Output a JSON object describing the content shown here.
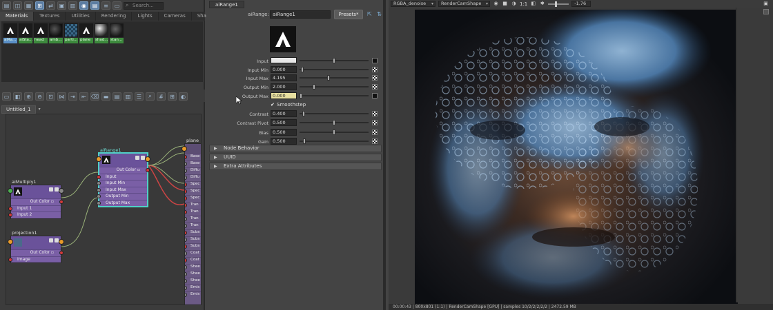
{
  "hypershade": {
    "search_placeholder": "Search...",
    "tabs": [
      "Materials",
      "Textures",
      "Utilities",
      "Rendering",
      "Lights",
      "Cameras",
      "Shading Gr"
    ],
    "swatches": [
      {
        "label": "aiRa...",
        "kind": "arnold"
      },
      {
        "label": "aiSta...",
        "kind": "arnold"
      },
      {
        "label": "head",
        "kind": "arnold"
      },
      {
        "label": "amb...",
        "kind": "dark"
      },
      {
        "label": "parti...",
        "kind": "checker"
      },
      {
        "label": "plane",
        "kind": "arnold"
      },
      {
        "label": "shad...",
        "kind": "sphere"
      },
      {
        "label": "stan...",
        "kind": "dark"
      }
    ],
    "graph_tab": "Untitled_1"
  },
  "nodes": {
    "multiply": {
      "title": "aiMultiply1",
      "out": "Out Color",
      "inputs": [
        "Input 1",
        "Input 2"
      ]
    },
    "projection": {
      "title": "projection1",
      "out": "Out Color",
      "inputs": [
        "Image"
      ]
    },
    "range": {
      "title": "aiRange1",
      "out": "Out Color",
      "inputs": [
        "Input",
        "Input Min",
        "Input Max",
        "Output Min",
        "Output Max"
      ]
    },
    "plane": {
      "title": "plane",
      "rows": [
        "Base",
        "Base",
        "Diffu",
        "Diffu",
        "Spec",
        "Spec",
        "Spec",
        "Tran",
        "Tran",
        "Tran",
        "Tran",
        "Subs",
        "Subs",
        "Subs",
        "Coat",
        "Coat",
        "Shee",
        "Shee",
        "Shee",
        "Emis",
        "Emis"
      ]
    }
  },
  "attribute_editor": {
    "tab": "aiRange1",
    "name_label": "aiRange:",
    "name_value": "aiRange1",
    "presets_label": "Presets*",
    "attributes": [
      {
        "label": "Input",
        "type": "color",
        "knob": 0.5,
        "map": "solid"
      },
      {
        "label": "Input Min",
        "type": "float",
        "value": "0.000",
        "knob": 0.02,
        "map": "check"
      },
      {
        "label": "Input Max",
        "type": "float",
        "value": "4.195",
        "knob": 0.42,
        "map": "check"
      },
      {
        "label": "Output Min",
        "type": "float",
        "value": "2.000",
        "knob": 0.2,
        "map": "check"
      },
      {
        "label": "Output Max",
        "type": "float",
        "value": "0.000",
        "knob": 0.0,
        "map": "solid",
        "highlight": true
      }
    ],
    "smoothstep_label": "Smoothstep",
    "attributes2": [
      {
        "label": "Contrast",
        "value": "0.400",
        "knob": 0.04,
        "map": "check"
      },
      {
        "label": "Contrast Pivot",
        "value": "0.500",
        "knob": 0.5,
        "map": "check"
      },
      {
        "label": "Bias",
        "value": "0.500",
        "knob": 0.5,
        "map": "check"
      },
      {
        "label": "Gain",
        "value": "0.500",
        "knob": 0.05,
        "map": "check"
      }
    ],
    "sections": [
      "Node Behavior",
      "UUID",
      "Extra Attributes"
    ]
  },
  "render_view": {
    "channel": "RGBA_denoise",
    "camera": "RenderCamShape",
    "ratio": "1:1",
    "exposure": "-1.76",
    "status": "00:00:43 | 800x801 (1:1) | RenderCamShape [GPU] | samples 10/2/2/2/2/2 | 2472.59 MB"
  }
}
